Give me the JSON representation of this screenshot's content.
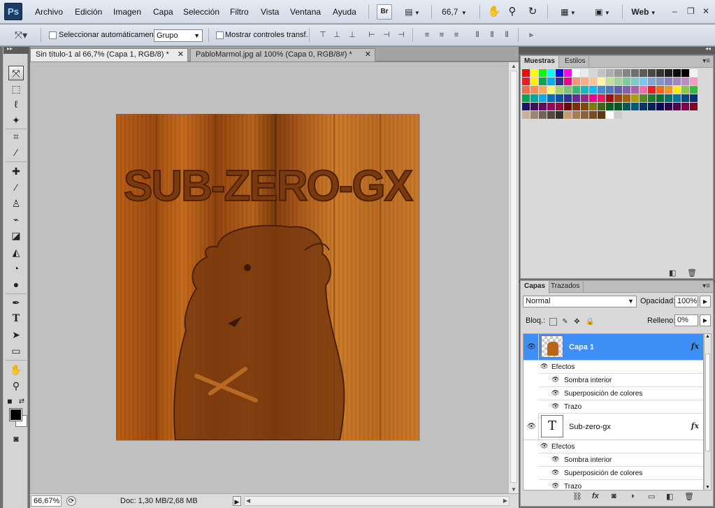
{
  "app": {
    "logo": "Ps",
    "menu": [
      "Archivo",
      "Edición",
      "Imagen",
      "Capa",
      "Selección",
      "Filtro",
      "Vista",
      "Ventana",
      "Ayuda"
    ],
    "bridge_label": "Br",
    "zoom_value": "66,7",
    "workspace": "Web",
    "window_controls": [
      "–",
      "❐",
      "✕"
    ]
  },
  "options": {
    "auto_select_label": "Seleccionar automáticamente:",
    "auto_select_value": "Grupo",
    "show_transform_label": "Mostrar controles transf."
  },
  "documents": {
    "tabs": [
      {
        "label": "Sin título-1 al 66,7% (Capa 1, RGB/8) *",
        "active": true
      },
      {
        "label": "PabloMarmol.jpg al 100% (Capa 0, RGB/8#) *",
        "active": false
      }
    ],
    "artwork_text": "SUB-ZERO-GX"
  },
  "status": {
    "zoom": "66,67%",
    "doc_info": "Doc: 1,30 MB/2,68 MB"
  },
  "swatches_panel": {
    "tabs": [
      "Muestras",
      "Estilos"
    ],
    "colors": [
      "#ff0000",
      "#ffff00",
      "#00ff00",
      "#00ffff",
      "#0000ff",
      "#ff00ff",
      "#ffffff",
      "#ebebeb",
      "#d6d6d6",
      "#c2c2c2",
      "#adadad",
      "#999999",
      "#858585",
      "#707070",
      "#5c5c5c",
      "#474747",
      "#333333",
      "#1f1f1f",
      "#0a0a0a",
      "#000000",
      "#f2f2f2",
      "#ed1c24",
      "#fff200",
      "#00a651",
      "#00aeef",
      "#2e3192",
      "#ec008c",
      "#f7977a",
      "#f9ad81",
      "#fdc68a",
      "#fff79a",
      "#c4df9b",
      "#a2d39c",
      "#82ca9d",
      "#7bcdc8",
      "#6ecff6",
      "#7ea7d8",
      "#8493ca",
      "#8882be",
      "#a187be",
      "#bc8dbf",
      "#f49ac2",
      "#f26c4f",
      "#f68e55",
      "#fbaf5c",
      "#fff467",
      "#acd372",
      "#7cc576",
      "#3bb878",
      "#1abbb4",
      "#00bff3",
      "#438ccb",
      "#5574b9",
      "#605ca8",
      "#855fa8",
      "#a763a8",
      "#f06ea9",
      "#ed1c24",
      "#f26522",
      "#f7941d",
      "#fff200",
      "#8dc63f",
      "#39b54a",
      "#00a651",
      "#00a99d",
      "#00aeef",
      "#0072bc",
      "#0054a6",
      "#2e3192",
      "#662d91",
      "#92278f",
      "#ec008c",
      "#ed145b",
      "#9e0b0f",
      "#a0410d",
      "#a36209",
      "#aba000",
      "#598527",
      "#197b30",
      "#007236",
      "#00746b",
      "#0076a3",
      "#004b80",
      "#003471",
      "#1b1464",
      "#440e62",
      "#630460",
      "#9e005d",
      "#9e0039",
      "#790000",
      "#7b2e00",
      "#7d4900",
      "#827b00",
      "#406618",
      "#005e20",
      "#005826",
      "#005952",
      "#005b7f",
      "#003663",
      "#002157",
      "#0d004c",
      "#32004b",
      "#4b0049",
      "#7b0046",
      "#7a0026",
      "#c7b299",
      "#998675",
      "#736357",
      "#534741",
      "#37302a",
      "#c69c6d",
      "#a67c52",
      "#8c6239",
      "#754c24",
      "#603913",
      "#ffffff",
      "#cccccc"
    ]
  },
  "layers_panel": {
    "tabs": [
      "Capas",
      "Trazados"
    ],
    "blend_mode": "Normal",
    "opacity_label": "Opacidad:",
    "opacity_value": "100%",
    "lock_label": "Bloq.:",
    "fill_label": "Relleno:",
    "fill_value": "0%",
    "layers": [
      {
        "name": "Capa 1",
        "selected": true,
        "fx": "fx",
        "effects_label": "Efectos",
        "effects": [
          "Sombra interior",
          "Superposición de colores",
          "Trazo"
        ]
      },
      {
        "name": "Sub-zero-gx",
        "selected": false,
        "fx": "fx",
        "thumb_text": "T",
        "effects_label": "Efectos",
        "effects": [
          "Sombra interior",
          "Superposición de colores",
          "Trazo"
        ]
      }
    ]
  }
}
